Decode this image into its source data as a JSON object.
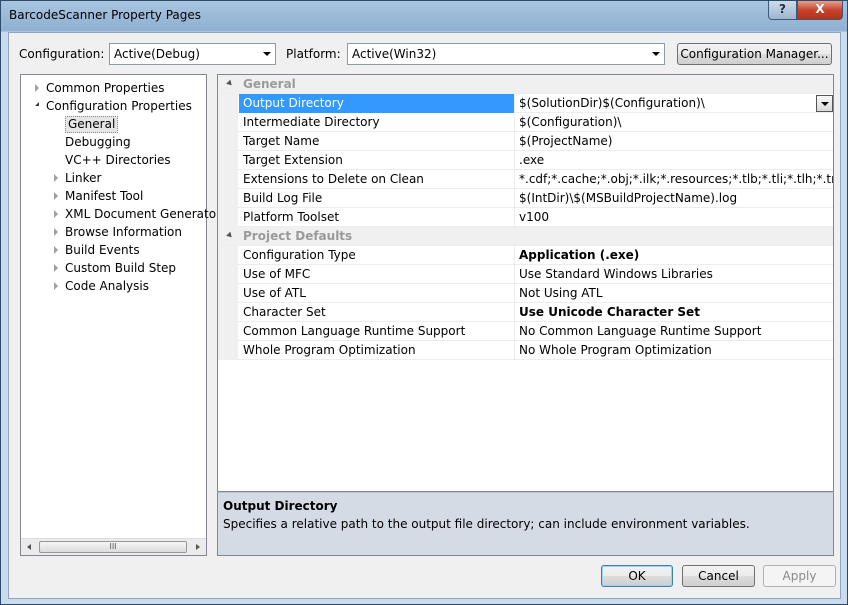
{
  "window": {
    "title": "BarcodeScanner Property Pages"
  },
  "titlebar": {
    "help_label": "?",
    "close_label": "X"
  },
  "toolbar": {
    "configuration_label": "Configuration:",
    "configuration_value": "Active(Debug)",
    "platform_label": "Platform:",
    "platform_value": "Active(Win32)",
    "config_manager_label": "Configuration Manager..."
  },
  "tree": {
    "items": [
      {
        "label": "Common Properties",
        "expander": "closed"
      },
      {
        "label": "Configuration Properties",
        "expander": "open"
      },
      {
        "label": "General",
        "expander": "none",
        "selected": true
      },
      {
        "label": "Debugging",
        "expander": "none"
      },
      {
        "label": "VC++ Directories",
        "expander": "none"
      },
      {
        "label": "Linker",
        "expander": "closed"
      },
      {
        "label": "Manifest Tool",
        "expander": "closed"
      },
      {
        "label": "XML Document Generator",
        "expander": "closed"
      },
      {
        "label": "Browse Information",
        "expander": "closed"
      },
      {
        "label": "Build Events",
        "expander": "closed"
      },
      {
        "label": "Custom Build Step",
        "expander": "closed"
      },
      {
        "label": "Code Analysis",
        "expander": "closed"
      }
    ],
    "scroll_thumb_label": "III"
  },
  "grid": {
    "categories": [
      {
        "name": "General",
        "rows": [
          {
            "name": "Output Directory",
            "value": "$(SolutionDir)$(Configuration)\\",
            "selected": true,
            "bold": false
          },
          {
            "name": "Intermediate Directory",
            "value": "$(Configuration)\\",
            "bold": false
          },
          {
            "name": "Target Name",
            "value": "$(ProjectName)",
            "bold": false
          },
          {
            "name": "Target Extension",
            "value": ".exe",
            "bold": false
          },
          {
            "name": "Extensions to Delete on Clean",
            "value": "*.cdf;*.cache;*.obj;*.ilk;*.resources;*.tlb;*.tli;*.tlh;*.tmp;*.rsp;*",
            "bold": false
          },
          {
            "name": "Build Log File",
            "value": "$(IntDir)\\$(MSBuildProjectName).log",
            "bold": false
          },
          {
            "name": "Platform Toolset",
            "value": "v100",
            "bold": false
          }
        ]
      },
      {
        "name": "Project Defaults",
        "rows": [
          {
            "name": "Configuration Type",
            "value": "Application (.exe)",
            "bold": true
          },
          {
            "name": "Use of MFC",
            "value": "Use Standard Windows Libraries",
            "bold": false
          },
          {
            "name": "Use of ATL",
            "value": "Not Using ATL",
            "bold": false
          },
          {
            "name": "Character Set",
            "value": "Use Unicode Character Set",
            "bold": true
          },
          {
            "name": "Common Language Runtime Support",
            "value": "No Common Language Runtime Support",
            "bold": false
          },
          {
            "name": "Whole Program Optimization",
            "value": "No Whole Program Optimization",
            "bold": false
          }
        ]
      }
    ]
  },
  "description": {
    "title": "Output Directory",
    "text": "Specifies a relative path to the output file directory; can include environment variables."
  },
  "buttons": {
    "ok": "OK",
    "cancel": "Cancel",
    "apply": "Apply"
  }
}
